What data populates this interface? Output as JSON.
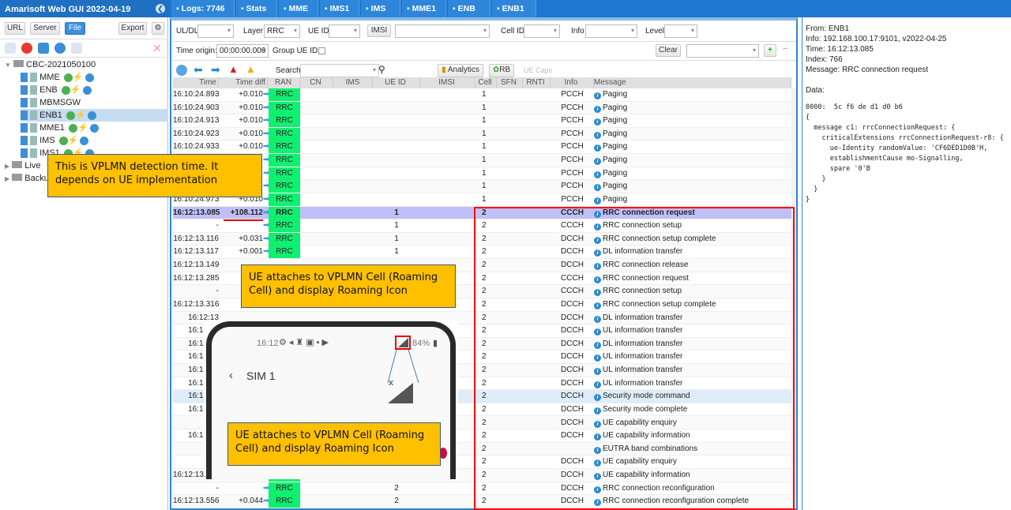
{
  "app": {
    "title": "Amarisoft Web GUI 2022-04-19"
  },
  "left": {
    "buttons": {
      "url": "URL",
      "server": "Server",
      "file": "File",
      "export": "Export"
    },
    "tree": [
      {
        "label": "CBC-2021050100",
        "level": 0
      },
      {
        "label": "MME",
        "level": 1,
        "status": true
      },
      {
        "label": "ENB",
        "level": 1,
        "status": true
      },
      {
        "label": "MBMSGW",
        "level": 1,
        "status": false
      },
      {
        "label": "ENB1",
        "level": 1,
        "status": true,
        "selected": true
      },
      {
        "label": "MME1",
        "level": 1,
        "status": true
      },
      {
        "label": "IMS",
        "level": 1,
        "status": true
      },
      {
        "label": "IMS1",
        "level": 1,
        "status": true
      },
      {
        "label": "Live",
        "level": 0
      },
      {
        "label": "Backup",
        "level": 0
      }
    ]
  },
  "tabs": [
    {
      "label": "Logs: 7746",
      "icon": "document-icon"
    },
    {
      "label": "Stats",
      "icon": "bar-chart-icon"
    },
    {
      "label": "MME",
      "icon": "server-icon"
    },
    {
      "label": "IMS1",
      "icon": "phone-icon"
    },
    {
      "label": "IMS",
      "icon": "phone-icon"
    },
    {
      "label": "MME1",
      "icon": "server-icon"
    },
    {
      "label": "ENB",
      "icon": "antenna-icon"
    },
    {
      "label": "ENB1",
      "icon": "antenna-icon"
    }
  ],
  "filters": {
    "uldl": "UL/DL",
    "layer": "Layer",
    "layer_value": "RRC",
    "ueid": "UE ID",
    "imsi": "IMSI",
    "cellid": "Cell ID",
    "info": "Info",
    "level": "Level",
    "time_origin": "Time origin:",
    "time_origin_value": "00:00:00.000",
    "group_ueid": "Group UE ID:",
    "clear": "Clear",
    "search": "Search",
    "analytics": "Analytics",
    "rb": "RB",
    "uecaps": "UE Caps"
  },
  "columns": [
    "Time",
    "Time diff",
    "RAN",
    "CN",
    "IMS",
    "UE ID",
    "IMSI",
    "Cell",
    "SFN",
    "RNTI",
    "Info",
    "Message"
  ],
  "rows": [
    {
      "t": "16:10:24.893",
      "d": "+0.010",
      "ran": "RRC",
      "ue": "",
      "c": "1",
      "i": "PCCH",
      "m": "Paging"
    },
    {
      "t": "16:10:24.903",
      "d": "+0.010",
      "ran": "RRC",
      "ue": "",
      "c": "1",
      "i": "PCCH",
      "m": "Paging"
    },
    {
      "t": "16:10:24.913",
      "d": "+0.010",
      "ran": "RRC",
      "ue": "",
      "c": "1",
      "i": "PCCH",
      "m": "Paging"
    },
    {
      "t": "16:10:24.923",
      "d": "+0.010",
      "ran": "RRC",
      "ue": "",
      "c": "1",
      "i": "PCCH",
      "m": "Paging"
    },
    {
      "t": "16:10:24.933",
      "d": "+0.010",
      "ran": "RRC",
      "ue": "",
      "c": "1",
      "i": "PCCH",
      "m": "Paging"
    },
    {
      "t": "",
      "d": "",
      "ran": "RRC",
      "ue": "",
      "c": "1",
      "i": "PCCH",
      "m": "Paging"
    },
    {
      "t": "",
      "d": "",
      "ran": "RRC",
      "ue": "",
      "c": "1",
      "i": "PCCH",
      "m": "Paging"
    },
    {
      "t": "",
      "d": "",
      "ran": "RRC",
      "ue": "",
      "c": "1",
      "i": "PCCH",
      "m": "Paging"
    },
    {
      "t": "16:10:24.973",
      "d": "+0.010",
      "ran": "RRC",
      "ue": "",
      "c": "1",
      "i": "PCCH",
      "m": "Paging"
    },
    {
      "t": "16:12:13.085",
      "d": "+108.112",
      "ran": "RRC",
      "ue": "1",
      "c": "2",
      "i": "CCCH",
      "m": "RRC connection request",
      "sel": true
    },
    {
      "t": "-",
      "d": "",
      "ran": "RRC",
      "ue": "1",
      "c": "2",
      "i": "CCCH",
      "m": "RRC connection setup"
    },
    {
      "t": "16:12:13.116",
      "d": "+0.031",
      "ran": "RRC",
      "ue": "1",
      "c": "2",
      "i": "DCCH",
      "m": "RRC connection setup complete"
    },
    {
      "t": "16:12:13.117",
      "d": "+0.001",
      "ran": "RRC",
      "ue": "1",
      "c": "2",
      "i": "DCCH",
      "m": "DL information transfer"
    },
    {
      "t": "16:12:13.149",
      "d": "",
      "ran": "",
      "ue": "",
      "c": "2",
      "i": "DCCH",
      "m": "RRC connection release"
    },
    {
      "t": "16:12:13.285",
      "d": "",
      "ran": "",
      "ue": "",
      "c": "2",
      "i": "CCCH",
      "m": "RRC connection request"
    },
    {
      "t": "-",
      "d": "",
      "ran": "",
      "ue": "",
      "c": "2",
      "i": "CCCH",
      "m": "RRC connection setup"
    },
    {
      "t": "16:12:13.316",
      "d": "",
      "ran": "",
      "ue": "",
      "c": "2",
      "i": "DCCH",
      "m": "RRC connection setup complete"
    },
    {
      "t": "16:12:13",
      "d": "",
      "ran": "",
      "ue": "",
      "c": "2",
      "i": "DCCH",
      "m": "DL information transfer"
    },
    {
      "t": "16:12:13",
      "d": "",
      "ran": "",
      "ue": "",
      "c": "2",
      "i": "DCCH",
      "m": "UL information transfer"
    },
    {
      "t": "16:12:13",
      "d": "",
      "ran": "",
      "ue": "",
      "c": "2",
      "i": "DCCH",
      "m": "DL information transfer"
    },
    {
      "t": "16:12:13",
      "d": "",
      "ran": "",
      "ue": "",
      "c": "2",
      "i": "DCCH",
      "m": "UL information transfer"
    },
    {
      "t": "16:12:13",
      "d": "",
      "ran": "",
      "ue": "",
      "c": "2",
      "i": "DCCH",
      "m": "UL information transfer"
    },
    {
      "t": "16:12:13",
      "d": "",
      "ran": "",
      "ue": "",
      "c": "2",
      "i": "DCCH",
      "m": "UL information transfer"
    },
    {
      "t": "16:12:13",
      "d": "",
      "ran": "",
      "ue": "",
      "c": "2",
      "i": "DCCH",
      "m": "Security mode command",
      "hl": true
    },
    {
      "t": "16:12:13",
      "d": "",
      "ran": "",
      "ue": "",
      "c": "2",
      "i": "DCCH",
      "m": "Security mode complete"
    },
    {
      "t": "",
      "d": "",
      "ran": "",
      "ue": "",
      "c": "2",
      "i": "DCCH",
      "m": "UE capability enquiry"
    },
    {
      "t": "16:12:13",
      "d": "",
      "ran": "",
      "ue": "",
      "c": "2",
      "i": "DCCH",
      "m": "UE capability information"
    },
    {
      "t": "",
      "d": "",
      "ran": "",
      "ue": "",
      "c": "2",
      "i": "",
      "m": "EUTRA band combinations"
    },
    {
      "t": "",
      "d": "",
      "ran": "",
      "ue": "",
      "c": "2",
      "i": "DCCH",
      "m": "UE capability enquiry"
    },
    {
      "t": "16:12:13.512",
      "d": "+0.056",
      "ran": "RRC",
      "ue": "2",
      "c": "2",
      "i": "DCCH",
      "m": "UE capability information"
    },
    {
      "t": "-",
      "d": "",
      "ran": "RRC",
      "ue": "2",
      "c": "2",
      "i": "DCCH",
      "m": "RRC connection reconfiguration"
    },
    {
      "t": "16:12:13.556",
      "d": "+0.044",
      "ran": "RRC",
      "ue": "2",
      "c": "2",
      "i": "DCCH",
      "m": "RRC connection reconfiguration complete"
    }
  ],
  "detail": {
    "from": "From: ENB1",
    "info": "Info: 192.168.100.17:9101, v2022-04-25",
    "time": "Time: 16:12:13.085",
    "index": "Index: 766",
    "message": "Message: RRC connection request",
    "data_label": "Data:",
    "code": "0000:  5c f6 de d1 d0 b6\n{\n  message c1: rrcConnectionRequest: {\n    criticalExtensions rrcConnectionRequest-r8: {\n      ue-Identity randomValue: 'CF6DED1D0B'H,\n      establishmentCause mo-Signalling,\n      spare '0'B\n    }\n  }\n}"
  },
  "phone": {
    "time": "16:12",
    "battery": "84%",
    "title": "SIM 1"
  },
  "callouts": {
    "detection": "This is VPLMN detection time. It depends on UE implementation",
    "attach1": "UE attaches to VPLMN Cell (Roaming Cell) and display Roaming Icon",
    "attach2": "UE attaches to VPLMN Cell (Roaming Cell) and display Roaming Icon"
  },
  "colors": {
    "accent": "#1c78d0",
    "ran": "#10f070",
    "selected_row": "#c0c0f8",
    "callout": "#ffc000",
    "highlight_box": "#ff0000"
  }
}
